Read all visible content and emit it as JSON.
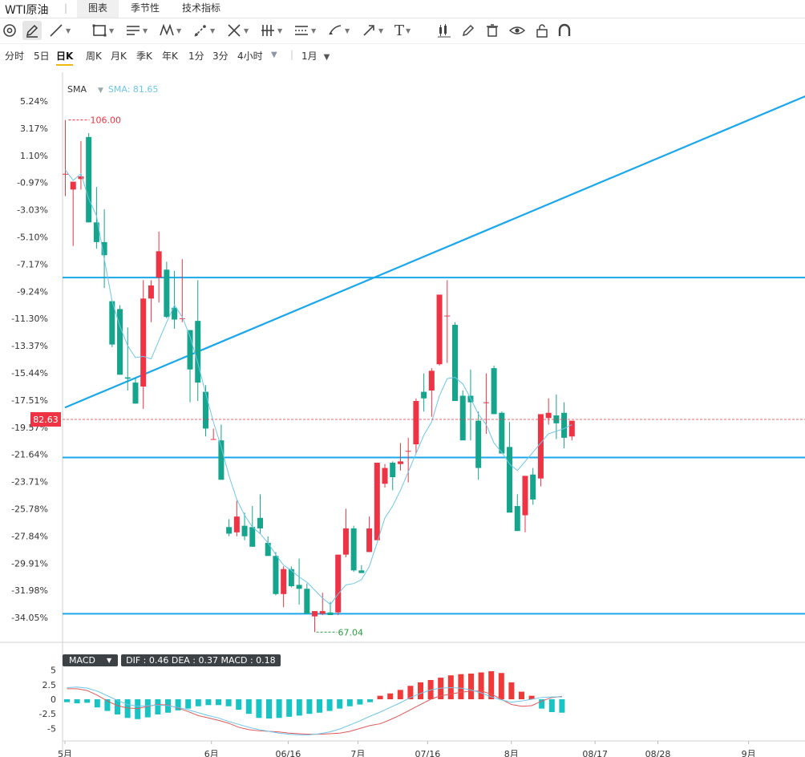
{
  "header": {
    "instrument": "WTI原油",
    "tabs": [
      {
        "label": "图表",
        "active": true
      },
      {
        "label": "季节性",
        "active": false
      },
      {
        "label": "技术指标",
        "active": false
      }
    ]
  },
  "toolbar": {
    "tools": [
      "settings-icon",
      "pencil-icon",
      "line-icon",
      "rectangle-icon",
      "parallel-lines-icon",
      "pattern-icon",
      "fib-icon",
      "measure-icon",
      "gann-icon",
      "channel-icon",
      "brush-icon",
      "arrow-icon",
      "text-icon",
      "candle-type-icon",
      "edit-icon",
      "trash-icon",
      "eye-icon",
      "lock-icon",
      "magnet-icon"
    ],
    "text_tool_label": "T"
  },
  "periods": {
    "items": [
      "分时",
      "5日",
      "日K",
      "周K",
      "月K",
      "季K",
      "年K",
      "1分",
      "3分",
      "4小时"
    ],
    "active": "日K",
    "range": "1月"
  },
  "legend": {
    "sma_label": "SMA",
    "sma_value_text": "SMA: 81.65"
  },
  "colors": {
    "up": "#ee3344",
    "down": "#14a58c",
    "sma": "#6ec6ea",
    "trendline": "#1aa7ec",
    "dif": "#e2595a",
    "dea": "#6ec6ea",
    "macd_up": "#f03a3a",
    "macd_down": "#17c3c3"
  },
  "chart_data": [
    {
      "type": "candlestick",
      "yaxis_ticks": [
        "5.24%",
        "3.17%",
        "1.10%",
        "-0.97%",
        "-3.03%",
        "-5.10%",
        "-7.17%",
        "-9.24%",
        "-11.30%",
        "-13.37%",
        "-15.44%",
        "-17.51%",
        "-19.57%",
        "-21.64%",
        "-23.71%",
        "-25.78%",
        "-27.84%",
        "-29.91%",
        "-31.98%",
        "-34.05%"
      ],
      "xaxis_ticks": [
        {
          "label": "5月",
          "day": 0
        },
        {
          "label": "6月",
          "day": 21
        },
        {
          "label": "06/16",
          "day": 32
        },
        {
          "label": "7月",
          "day": 42
        },
        {
          "label": "07/16",
          "day": 52
        },
        {
          "label": "8月",
          "day": 64
        },
        {
          "label": "08/17",
          "day": 76
        },
        {
          "label": "08/28",
          "day": 85
        },
        {
          "label": "9月",
          "day": 98
        },
        {
          "label": "9",
          "day": 107
        }
      ],
      "ohlc_pct": [
        [
          -0.3,
          3.8,
          -2,
          -0.3
        ],
        [
          -1.5,
          -0.9,
          -5.8,
          -0.9
        ],
        [
          -0.7,
          2.2,
          -1.5,
          -0.5
        ],
        [
          2.5,
          2.8,
          -4,
          -4
        ],
        [
          -4,
          -1.3,
          -6,
          -5.5
        ],
        [
          -5.5,
          -3,
          -9,
          -6.5
        ],
        [
          -10,
          -10,
          -13.5,
          -13.3
        ],
        [
          -10.6,
          -10.3,
          -15.6,
          -15.6
        ],
        [
          -15.8,
          -12,
          -16.8,
          -15.9
        ],
        [
          -16.2,
          -15.8,
          -17.8,
          -17.8
        ],
        [
          -16.5,
          -8.4,
          -18.2,
          -9.8
        ],
        [
          -9.8,
          -8.4,
          -11.6,
          -8.8
        ],
        [
          -8.2,
          -4.7,
          -10.1,
          -6.2
        ],
        [
          -7.6,
          -7,
          -11.3,
          -11.2
        ],
        [
          -10.5,
          -7.7,
          -12.1,
          -11.4
        ],
        [
          -11.3,
          -6.8,
          -11.6,
          -11.3
        ],
        [
          -12.2,
          -12.2,
          -17.7,
          -15.2
        ],
        [
          -11.5,
          -8.4,
          -17.6,
          -16.2
        ],
        [
          -16.9,
          -16.4,
          -20.3,
          -19.7
        ],
        [
          -20.5,
          -19.7,
          -20.5,
          -20.5
        ],
        [
          -20.6,
          -19.4,
          -22.6,
          -23.6
        ],
        [
          -27.2,
          -26.6,
          -27.9,
          -27.7
        ],
        [
          -27.6,
          -25.2,
          -27.9,
          -26.4
        ],
        [
          -27.1,
          -26.1,
          -28.2,
          -27.9
        ],
        [
          -27.2,
          -25.6,
          -28.5,
          -28.7
        ],
        [
          -26.5,
          -24.7,
          -27.7,
          -27.3
        ],
        [
          -28.4,
          -27.9,
          -29.1,
          -29.4
        ],
        [
          -29.4,
          -29.1,
          -32.4,
          -32.3
        ],
        [
          -32.3,
          -30.2,
          -33.3,
          -30.4
        ],
        [
          -30.4,
          -30.2,
          -31.8,
          -31.7
        ],
        [
          -31.6,
          -29.6,
          -33.1,
          -31.9
        ],
        [
          -31.9,
          -31.5,
          -33.6,
          -33.8
        ],
        [
          -34,
          -33.6,
          -35.2,
          -33.6
        ],
        [
          -33.8,
          -32.2,
          -33.9,
          -33.6
        ],
        [
          -33.7,
          -32.9,
          -33.9,
          -33.9
        ],
        [
          -33.7,
          -31.2,
          -33.9,
          -29.3
        ],
        [
          -29.3,
          -25.8,
          -29.5,
          -27.3
        ],
        [
          -27.3,
          -27.1,
          -30.6,
          -30.5
        ],
        [
          -30.5,
          -30.1,
          -30.7,
          -30.7
        ],
        [
          -29.1,
          -26.4,
          -29.1,
          -27.3
        ],
        [
          -28.2,
          -22.7,
          -28.2,
          -22.3
        ],
        [
          -23.9,
          -22.4,
          -24.2,
          -22.7
        ],
        [
          -22.3,
          -22.2,
          -24.4,
          -23.4
        ],
        [
          -22.4,
          -20.8,
          -22.9,
          -22.2
        ],
        [
          -21.4,
          -20.4,
          -23.8,
          -21.4
        ],
        [
          -20.9,
          -17.4,
          -21.6,
          -17.6
        ],
        [
          -16.9,
          -15.5,
          -18.4,
          -17.4
        ],
        [
          -16.8,
          -15.1,
          -18.8,
          -15.3
        ],
        [
          -14.8,
          -9.7,
          -14.9,
          -9.5
        ],
        [
          -11.1,
          -8.4,
          -14.7,
          -11.1
        ],
        [
          -11.8,
          -11.6,
          -17.4,
          -17.6
        ],
        [
          -17.2,
          -16.8,
          -19.9,
          -20.6
        ],
        [
          -17.2,
          -15.2,
          -20.6,
          -17.7
        ],
        [
          -19.1,
          -18.4,
          -23.6,
          -22.7
        ],
        [
          -17.7,
          -15.5,
          -20.1,
          -17.7
        ],
        [
          -15.1,
          -14.9,
          -18.6,
          -18.6
        ],
        [
          -18.5,
          -18.4,
          -21.4,
          -21.6
        ],
        [
          -21.1,
          -19.2,
          -25.1,
          -26.1
        ],
        [
          -25.6,
          -24.7,
          -27.5,
          -27.5
        ],
        [
          -26.3,
          -23.6,
          -27.6,
          -23.3
        ],
        [
          -23.2,
          -22.7,
          -25.5,
          -25.1
        ],
        [
          -23.5,
          -20.8,
          -24.1,
          -18.6
        ],
        [
          -18.9,
          -17.4,
          -19.4,
          -18.5
        ],
        [
          -18.7,
          -17.1,
          -20.5,
          -19.3
        ],
        [
          -18.5,
          -17.7,
          -21.2,
          -20.4
        ],
        [
          -20.3,
          -19.3,
          -20.6,
          -19.1
        ]
      ],
      "sma": [
        0,
        -0.8,
        -0.3,
        -2.2,
        -3.5,
        -6.8,
        -10,
        -11.9,
        -13.4,
        -14.3,
        -14.2,
        -14.4,
        -13,
        -11.6,
        -10.3,
        -11.2,
        -12.7,
        -14.7,
        -17,
        -19.2,
        -21.1,
        -23.3,
        -25.1,
        -26.3,
        -27.2,
        -27.7,
        -28.4,
        -29.3,
        -30.1,
        -30.5,
        -31,
        -31.4,
        -32,
        -32.6,
        -33.1,
        -32.3,
        -31.6,
        -31.5,
        -31.2,
        -30.2,
        -28.4,
        -26.5,
        -25.6,
        -24.4,
        -23,
        -21.6,
        -20.2,
        -19.2,
        -17.2,
        -15.9,
        -15.8,
        -16.3,
        -17.4,
        -18.6,
        -19.4,
        -20.8,
        -21.5,
        -22.4,
        -22.9,
        -22.2,
        -21.5,
        -20.8,
        -20.1,
        -19.9,
        -19.7,
        -19.4
      ],
      "trendlines": [
        {
          "kind": "diagonal",
          "from": {
            "day": 0,
            "value": -18.1
          },
          "to": {
            "day": 107,
            "value": 5.8
          }
        },
        {
          "kind": "horizontal",
          "value": -8.2
        },
        {
          "kind": "horizontal",
          "value": -21.9
        },
        {
          "kind": "horizontal",
          "value": -33.8
        }
      ],
      "markers": {
        "max_label": "106.00",
        "max_value_pct": 3.8,
        "min_label": "67.04",
        "min_value_pct": -35.2,
        "last_price_label": "82.63",
        "last_price_pct": -19.0
      }
    },
    {
      "type": "macd",
      "title": "MACD",
      "values_text": "DIF : 0.46  DEA : 0.37  MACD : 0.18",
      "yaxis_ticks": [
        "5",
        "2.5",
        "0",
        "-2.5",
        "-5"
      ],
      "dif": [
        1.8,
        1.8,
        1.5,
        0.7,
        -0.3,
        -1.1,
        -1.5,
        -1.6,
        -1.2,
        -0.9,
        -1,
        -1.5,
        -2.1,
        -2.8,
        -3.2,
        -3.6,
        -4.1,
        -4.8,
        -5.2,
        -5.4,
        -5.5,
        -5.6,
        -5.8,
        -5.9,
        -6,
        -6,
        -5.9,
        -5.8,
        -5.5,
        -5,
        -4.5,
        -4.2,
        -3.5,
        -2.7,
        -1.8,
        -0.9,
        0,
        0.6,
        0.9,
        1.2,
        1.4,
        1.4,
        0.9,
        0,
        -0.9,
        -1.2,
        -1.1,
        -0.3,
        0.3,
        0.5
      ],
      "dea": [
        2,
        2.1,
        1.9,
        1.4,
        0.6,
        -0.2,
        -0.9,
        -1.2,
        -1.1,
        -1,
        -1.1,
        -1.4,
        -1.8,
        -2.3,
        -2.8,
        -3.2,
        -3.8,
        -4.3,
        -4.8,
        -5.2,
        -5.5,
        -5.8,
        -6,
        -6.1,
        -6.1,
        -5.9,
        -5.6,
        -5.1,
        -4.4,
        -3.7,
        -2.9,
        -2.2,
        -1.4,
        -0.6,
        0.3,
        1,
        1.6,
        1.9,
        2,
        1.9,
        1.6,
        1.1,
        0.4,
        -0.1,
        -0.5,
        -0.3,
        0,
        0.3,
        0.4,
        0.4
      ],
      "histogram": [
        -0.5,
        -0.7,
        -0.6,
        -1.4,
        -2,
        -2.6,
        -3.2,
        -3.4,
        -3.1,
        -2.6,
        -2.3,
        -1.9,
        -1.6,
        -1.2,
        -1,
        -1,
        -1.2,
        -1.8,
        -2.5,
        -3.2,
        -3.3,
        -3.2,
        -3,
        -2.8,
        -2.5,
        -2.3,
        -2,
        -1.6,
        -1.2,
        -0.9,
        -0.5,
        0.6,
        1,
        1.6,
        2.3,
        2.9,
        3.3,
        3.7,
        4.1,
        4.3,
        4.4,
        4.6,
        4.8,
        4.5,
        2.9,
        1.3,
        0.6,
        -1.6,
        -2.2,
        -2.3
      ]
    }
  ]
}
